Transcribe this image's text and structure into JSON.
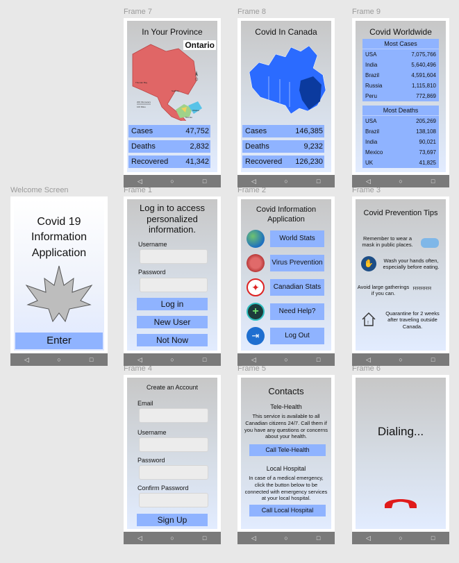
{
  "labels": {
    "frame7": "Frame 7",
    "frame8": "Frame 8",
    "frame9": "Frame 9",
    "welcome": "Welcome Screen",
    "frame1": "Frame 1",
    "frame2": "Frame 2",
    "frame3": "Frame 3",
    "frame4": "Frame 4",
    "frame5": "Frame 5",
    "frame6": "Frame 6"
  },
  "nav": {
    "back": "◁",
    "home": "○",
    "recent": "□"
  },
  "province": {
    "title": "In Your Province",
    "map_label": "Ontario",
    "stats": [
      {
        "label": "Cases",
        "value": "47,752"
      },
      {
        "label": "Deaths",
        "value": "2,832"
      },
      {
        "label": "Recovered",
        "value": "41,342"
      }
    ]
  },
  "canada": {
    "title": "Covid In Canada",
    "stats": [
      {
        "label": "Cases",
        "value": "146,385"
      },
      {
        "label": "Deaths",
        "value": "9,232"
      },
      {
        "label": "Recovered",
        "value": "126,230"
      }
    ]
  },
  "worldwide": {
    "title": "Covid Worldwide",
    "cases_header": "Most Cases",
    "cases": [
      {
        "country": "USA",
        "value": "7,075,766"
      },
      {
        "country": "India",
        "value": "5,640,496"
      },
      {
        "country": "Brazil",
        "value": "4,591,604"
      },
      {
        "country": "Russia",
        "value": "1,115,810"
      },
      {
        "country": "Peru",
        "value": "772,869"
      }
    ],
    "deaths_header": "Most Deaths",
    "deaths": [
      {
        "country": "USA",
        "value": "205,269"
      },
      {
        "country": "Brazil",
        "value": "138,108"
      },
      {
        "country": "India",
        "value": "90,021"
      },
      {
        "country": "Mexico",
        "value": "73,697"
      },
      {
        "country": "UK",
        "value": "41,825"
      }
    ]
  },
  "welcome": {
    "title": "Covid 19 Information Application",
    "enter": "Enter"
  },
  "login": {
    "title": "Log in to access personalized information.",
    "username_label": "Username",
    "password_label": "Password",
    "login_btn": "Log in",
    "new_user_btn": "New User",
    "not_now_btn": "Not Now"
  },
  "menu": {
    "title": "Covid Information Application",
    "items": [
      "World Stats",
      "Virus Prevention",
      "Canadian Stats",
      "Need Help?",
      "Log Out"
    ]
  },
  "tips": {
    "title": "Covid Prevention Tips",
    "items": [
      "Remember to wear a mask in public places.",
      "Wash your hands often, especially before eating.",
      "Avoid large gatherings if you can.",
      "Quarantine for 2 weeks after traveling outside Canada."
    ]
  },
  "account": {
    "title": "Create an Account",
    "email": "Email",
    "username": "Username",
    "password": "Password",
    "confirm": "Confirm Password",
    "signup": "Sign Up"
  },
  "contacts": {
    "title": "Contacts",
    "telehealth_title": "Tele-Health",
    "telehealth_text": "This service is available to all Canadian citizens 24/7. Call them if you have any questions or concerns about your health.",
    "telehealth_btn": "Call Tele-Health",
    "hospital_title": "Local Hospital",
    "hospital_text": "In case of a medical emergency, click the button below to be connected with emergency services at your local hospital.",
    "hospital_btn": "Call Local Hospital"
  },
  "dialing": {
    "text": "Dialing..."
  },
  "colors": {
    "accent": "#8fb3ff",
    "navbar": "#7a7a7a",
    "ontario": "#e06666",
    "canada": "#2b6bff",
    "quebec": "#0b3a9e",
    "hangup": "#e01b1b"
  }
}
